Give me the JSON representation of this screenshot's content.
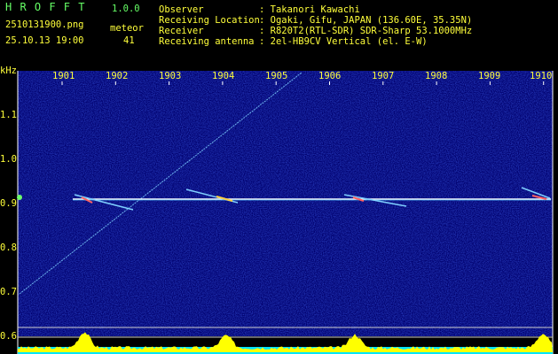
{
  "app": {
    "name": "H R O F F T",
    "version": "1.0.0",
    "filename": "2510131900.png",
    "datetime": "25.10.13 19:00",
    "meteor_label": "meteor",
    "meteor_count": "41"
  },
  "info": {
    "rows": [
      {
        "label": "Observer",
        "value": ": Takanori Kawachi"
      },
      {
        "label": "Receiving Location",
        "value": ": Ogaki, Gifu, JAPAN (136.60E, 35.35N)"
      },
      {
        "label": "Receiver",
        "value": ": R820T2(RTL-SDR) SDR-Sharp 53.1000MHz"
      },
      {
        "label": "Receiving antenna",
        "value": ": 2el-HB9CV Vertical (el. E-W)"
      }
    ]
  },
  "axes": {
    "y_unit": "kHz",
    "y_ticks": [
      "1.1",
      "1.0",
      "0.9",
      "0.8",
      "0.7",
      "0.6"
    ],
    "x_ticks": [
      "1901",
      "1902",
      "1903",
      "1904",
      "1905",
      "1906",
      "1907",
      "1908",
      "1909",
      "1910"
    ]
  },
  "colors": {
    "background": "#000000",
    "spectrogram_bg": "#000070",
    "header_text": "#ffff3a",
    "title_text": "#66ff66",
    "info_text": "#ffffff",
    "tick_text": "#ffff3a",
    "grid": "#cccccc",
    "carrier": "#ffffff",
    "meteor_trail": "#7fd0ff",
    "level_bars": "#ffff00",
    "level_base": "#00e5ff"
  }
}
